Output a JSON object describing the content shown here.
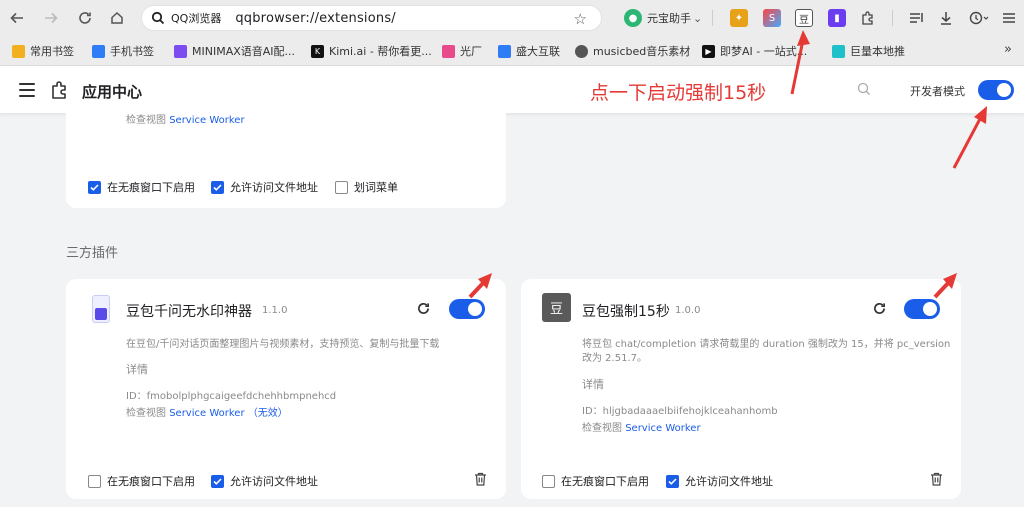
{
  "browser": {
    "address_label": "QQ浏览器",
    "url": "qqbrowser://extensions/",
    "assistant_label": "元宝助手",
    "assistant_caret": "⌄"
  },
  "bookmarks": [
    {
      "label": "常用书签",
      "color": "#f2b01e"
    },
    {
      "label": "手机书签",
      "color": "#2e7cf6"
    },
    {
      "label": "MINIMAX语音AI配...",
      "color": "#7b4cf0"
    },
    {
      "label": "Kimi.ai - 帮你看更...",
      "color": "#111111"
    },
    {
      "label": "光厂",
      "color": "#e84a8a"
    },
    {
      "label": "盛大互联",
      "color": "#2e7cf6"
    },
    {
      "label": "musicbed音乐素材",
      "color": "#555555"
    },
    {
      "label": "即梦AI - 一站式...",
      "color": "#111111"
    },
    {
      "label": "巨量本地推",
      "color": "#1ec0c9"
    }
  ],
  "bookmarks_more": "»",
  "header": {
    "title": "应用中心",
    "annotation": "点一下启动强制15秒",
    "dev_mode_label": "开发者模式",
    "dev_mode_on": true
  },
  "top_card": {
    "inspect_prefix": "检查视图",
    "inspect_link": "Service Worker",
    "checkboxes": [
      {
        "label": "在无痕窗口下启用",
        "checked": true
      },
      {
        "label": "允许访问文件地址",
        "checked": true
      },
      {
        "label": "划词菜单",
        "checked": false
      }
    ]
  },
  "section_label": "三方插件",
  "extensions": [
    {
      "name": "豆包千问无水印神器",
      "version": "1.1.0",
      "description": "在豆包/千问对话页面整理图片与视频素材，支持预览、复制与批量下载",
      "details": "详情",
      "id_line": "ID：fmobolplphgcaigeefdchehhbmpnehcd",
      "inspect_prefix": "检查视图",
      "inspect_link": "Service Worker",
      "inspect_suffix": "（无效）",
      "enabled": true,
      "checkboxes": [
        {
          "label": "在无痕窗口下启用",
          "checked": false
        },
        {
          "label": "允许访问文件地址",
          "checked": true
        }
      ]
    },
    {
      "name": "豆包强制15秒",
      "version": "1.0.0",
      "icon_text": "豆",
      "description_line1": "将豆包 chat/completion 请求荷载里的 duration 强制改为 15，并将 pc_version",
      "description_line2": "改为 2.51.7。",
      "details": "详情",
      "id_line": "ID：hljgbadaaaelbiifehojklceahanhomb",
      "inspect_prefix": "检查视图",
      "inspect_link": "Service Worker",
      "enabled": true,
      "checkboxes": [
        {
          "label": "在无痕窗口下启用",
          "checked": false
        },
        {
          "label": "允许访问文件地址",
          "checked": true
        }
      ]
    }
  ],
  "colors": {
    "accent": "#1a5de8",
    "annotation_red": "#e53935",
    "page_bg": "#f1f3f4"
  }
}
